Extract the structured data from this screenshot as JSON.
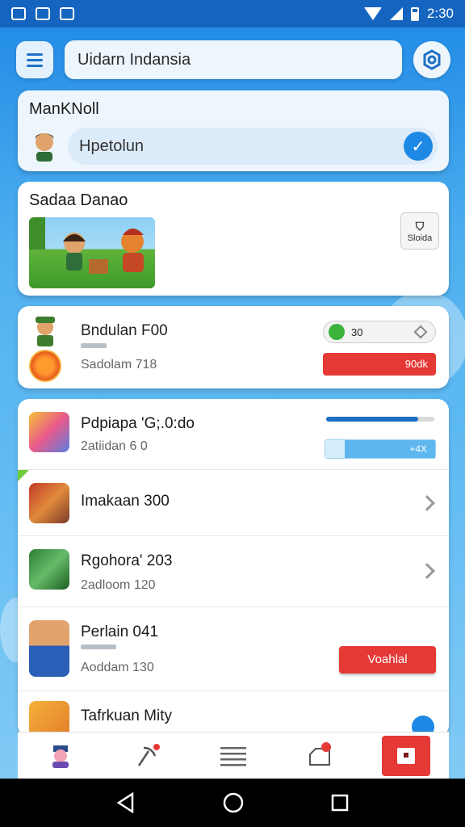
{
  "status_bar": {
    "time": "2:30"
  },
  "header": {
    "search_value": "Uidarn Indansia"
  },
  "profile_card": {
    "title": "ManKNoll",
    "input_value": "Hpetolun"
  },
  "featured_card": {
    "title": "Sadaa Danao",
    "side_button_label": "Sloida"
  },
  "stats_card": {
    "title": "Bndulan F00",
    "subtitle": "Sadolam 718",
    "toggle_value": "30",
    "red_button_label": "90dk"
  },
  "list": [
    {
      "title": "Pdpiapa 'G;.0:do",
      "subtitle": "2atiidan 6 0",
      "control": "progress",
      "progress": 0.85,
      "field_label": "+4X"
    },
    {
      "title": "Imakaan 300",
      "subtitle": "",
      "control": "chevron"
    },
    {
      "title": "Rgohora' 203",
      "subtitle": "2adloom 120",
      "control": "chevron"
    },
    {
      "title": "Perlain 041",
      "subtitle": "Aoddam 130",
      "control": "button",
      "button_label": "Voahlal"
    },
    {
      "title": "Tafrkuan Mity",
      "subtitle": "",
      "control": "fab"
    }
  ],
  "bottom_nav": [
    "profile-tab",
    "pickaxe-tab",
    "menu-tab",
    "inbox-tab",
    "active-tab"
  ],
  "colors": {
    "primary": "#1e88e5",
    "danger": "#e53935",
    "success": "#3bb33b"
  }
}
